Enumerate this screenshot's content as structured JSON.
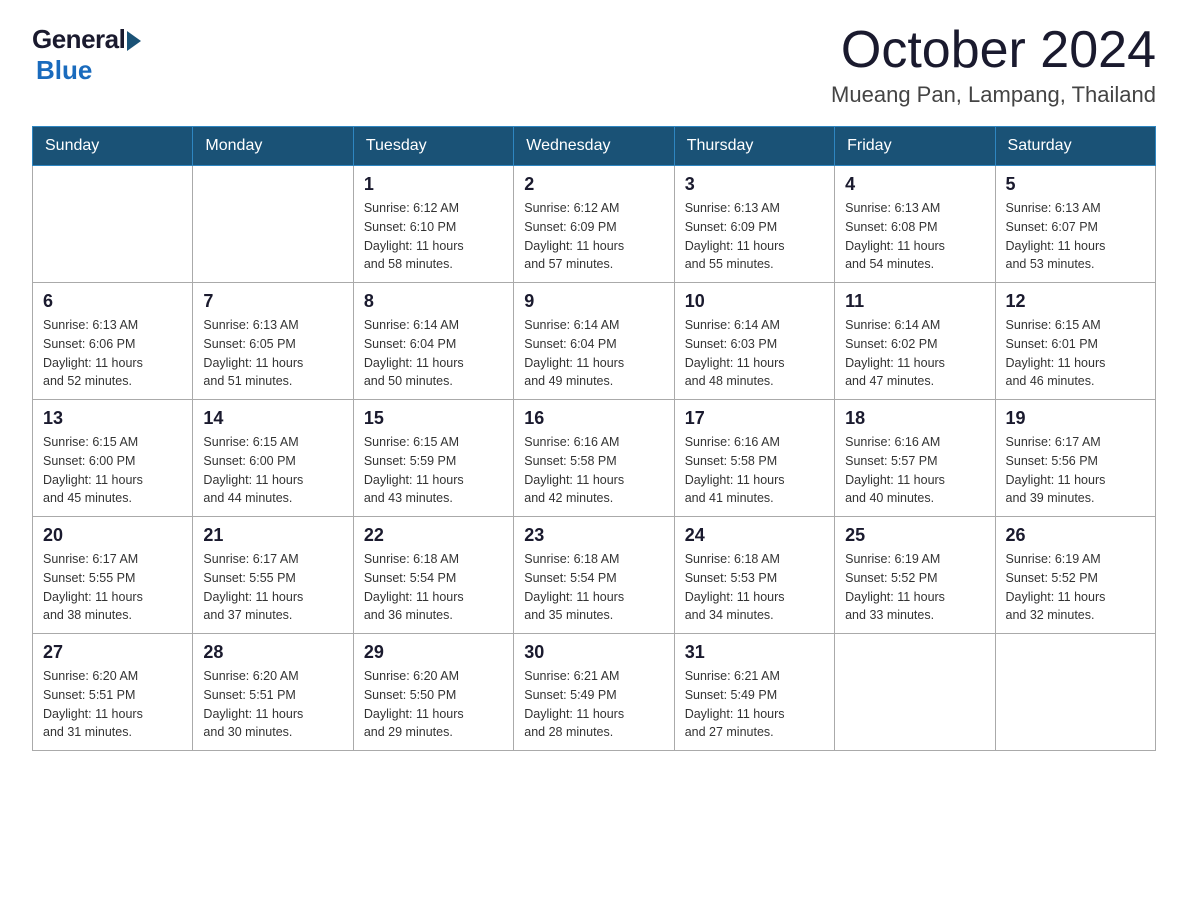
{
  "logo": {
    "general": "General",
    "blue": "Blue"
  },
  "title": "October 2024",
  "location": "Mueang Pan, Lampang, Thailand",
  "headers": [
    "Sunday",
    "Monday",
    "Tuesday",
    "Wednesday",
    "Thursday",
    "Friday",
    "Saturday"
  ],
  "weeks": [
    [
      {
        "day": "",
        "info": ""
      },
      {
        "day": "",
        "info": ""
      },
      {
        "day": "1",
        "info": "Sunrise: 6:12 AM\nSunset: 6:10 PM\nDaylight: 11 hours\nand 58 minutes."
      },
      {
        "day": "2",
        "info": "Sunrise: 6:12 AM\nSunset: 6:09 PM\nDaylight: 11 hours\nand 57 minutes."
      },
      {
        "day": "3",
        "info": "Sunrise: 6:13 AM\nSunset: 6:09 PM\nDaylight: 11 hours\nand 55 minutes."
      },
      {
        "day": "4",
        "info": "Sunrise: 6:13 AM\nSunset: 6:08 PM\nDaylight: 11 hours\nand 54 minutes."
      },
      {
        "day": "5",
        "info": "Sunrise: 6:13 AM\nSunset: 6:07 PM\nDaylight: 11 hours\nand 53 minutes."
      }
    ],
    [
      {
        "day": "6",
        "info": "Sunrise: 6:13 AM\nSunset: 6:06 PM\nDaylight: 11 hours\nand 52 minutes."
      },
      {
        "day": "7",
        "info": "Sunrise: 6:13 AM\nSunset: 6:05 PM\nDaylight: 11 hours\nand 51 minutes."
      },
      {
        "day": "8",
        "info": "Sunrise: 6:14 AM\nSunset: 6:04 PM\nDaylight: 11 hours\nand 50 minutes."
      },
      {
        "day": "9",
        "info": "Sunrise: 6:14 AM\nSunset: 6:04 PM\nDaylight: 11 hours\nand 49 minutes."
      },
      {
        "day": "10",
        "info": "Sunrise: 6:14 AM\nSunset: 6:03 PM\nDaylight: 11 hours\nand 48 minutes."
      },
      {
        "day": "11",
        "info": "Sunrise: 6:14 AM\nSunset: 6:02 PM\nDaylight: 11 hours\nand 47 minutes."
      },
      {
        "day": "12",
        "info": "Sunrise: 6:15 AM\nSunset: 6:01 PM\nDaylight: 11 hours\nand 46 minutes."
      }
    ],
    [
      {
        "day": "13",
        "info": "Sunrise: 6:15 AM\nSunset: 6:00 PM\nDaylight: 11 hours\nand 45 minutes."
      },
      {
        "day": "14",
        "info": "Sunrise: 6:15 AM\nSunset: 6:00 PM\nDaylight: 11 hours\nand 44 minutes."
      },
      {
        "day": "15",
        "info": "Sunrise: 6:15 AM\nSunset: 5:59 PM\nDaylight: 11 hours\nand 43 minutes."
      },
      {
        "day": "16",
        "info": "Sunrise: 6:16 AM\nSunset: 5:58 PM\nDaylight: 11 hours\nand 42 minutes."
      },
      {
        "day": "17",
        "info": "Sunrise: 6:16 AM\nSunset: 5:58 PM\nDaylight: 11 hours\nand 41 minutes."
      },
      {
        "day": "18",
        "info": "Sunrise: 6:16 AM\nSunset: 5:57 PM\nDaylight: 11 hours\nand 40 minutes."
      },
      {
        "day": "19",
        "info": "Sunrise: 6:17 AM\nSunset: 5:56 PM\nDaylight: 11 hours\nand 39 minutes."
      }
    ],
    [
      {
        "day": "20",
        "info": "Sunrise: 6:17 AM\nSunset: 5:55 PM\nDaylight: 11 hours\nand 38 minutes."
      },
      {
        "day": "21",
        "info": "Sunrise: 6:17 AM\nSunset: 5:55 PM\nDaylight: 11 hours\nand 37 minutes."
      },
      {
        "day": "22",
        "info": "Sunrise: 6:18 AM\nSunset: 5:54 PM\nDaylight: 11 hours\nand 36 minutes."
      },
      {
        "day": "23",
        "info": "Sunrise: 6:18 AM\nSunset: 5:54 PM\nDaylight: 11 hours\nand 35 minutes."
      },
      {
        "day": "24",
        "info": "Sunrise: 6:18 AM\nSunset: 5:53 PM\nDaylight: 11 hours\nand 34 minutes."
      },
      {
        "day": "25",
        "info": "Sunrise: 6:19 AM\nSunset: 5:52 PM\nDaylight: 11 hours\nand 33 minutes."
      },
      {
        "day": "26",
        "info": "Sunrise: 6:19 AM\nSunset: 5:52 PM\nDaylight: 11 hours\nand 32 minutes."
      }
    ],
    [
      {
        "day": "27",
        "info": "Sunrise: 6:20 AM\nSunset: 5:51 PM\nDaylight: 11 hours\nand 31 minutes."
      },
      {
        "day": "28",
        "info": "Sunrise: 6:20 AM\nSunset: 5:51 PM\nDaylight: 11 hours\nand 30 minutes."
      },
      {
        "day": "29",
        "info": "Sunrise: 6:20 AM\nSunset: 5:50 PM\nDaylight: 11 hours\nand 29 minutes."
      },
      {
        "day": "30",
        "info": "Sunrise: 6:21 AM\nSunset: 5:49 PM\nDaylight: 11 hours\nand 28 minutes."
      },
      {
        "day": "31",
        "info": "Sunrise: 6:21 AM\nSunset: 5:49 PM\nDaylight: 11 hours\nand 27 minutes."
      },
      {
        "day": "",
        "info": ""
      },
      {
        "day": "",
        "info": ""
      }
    ]
  ]
}
